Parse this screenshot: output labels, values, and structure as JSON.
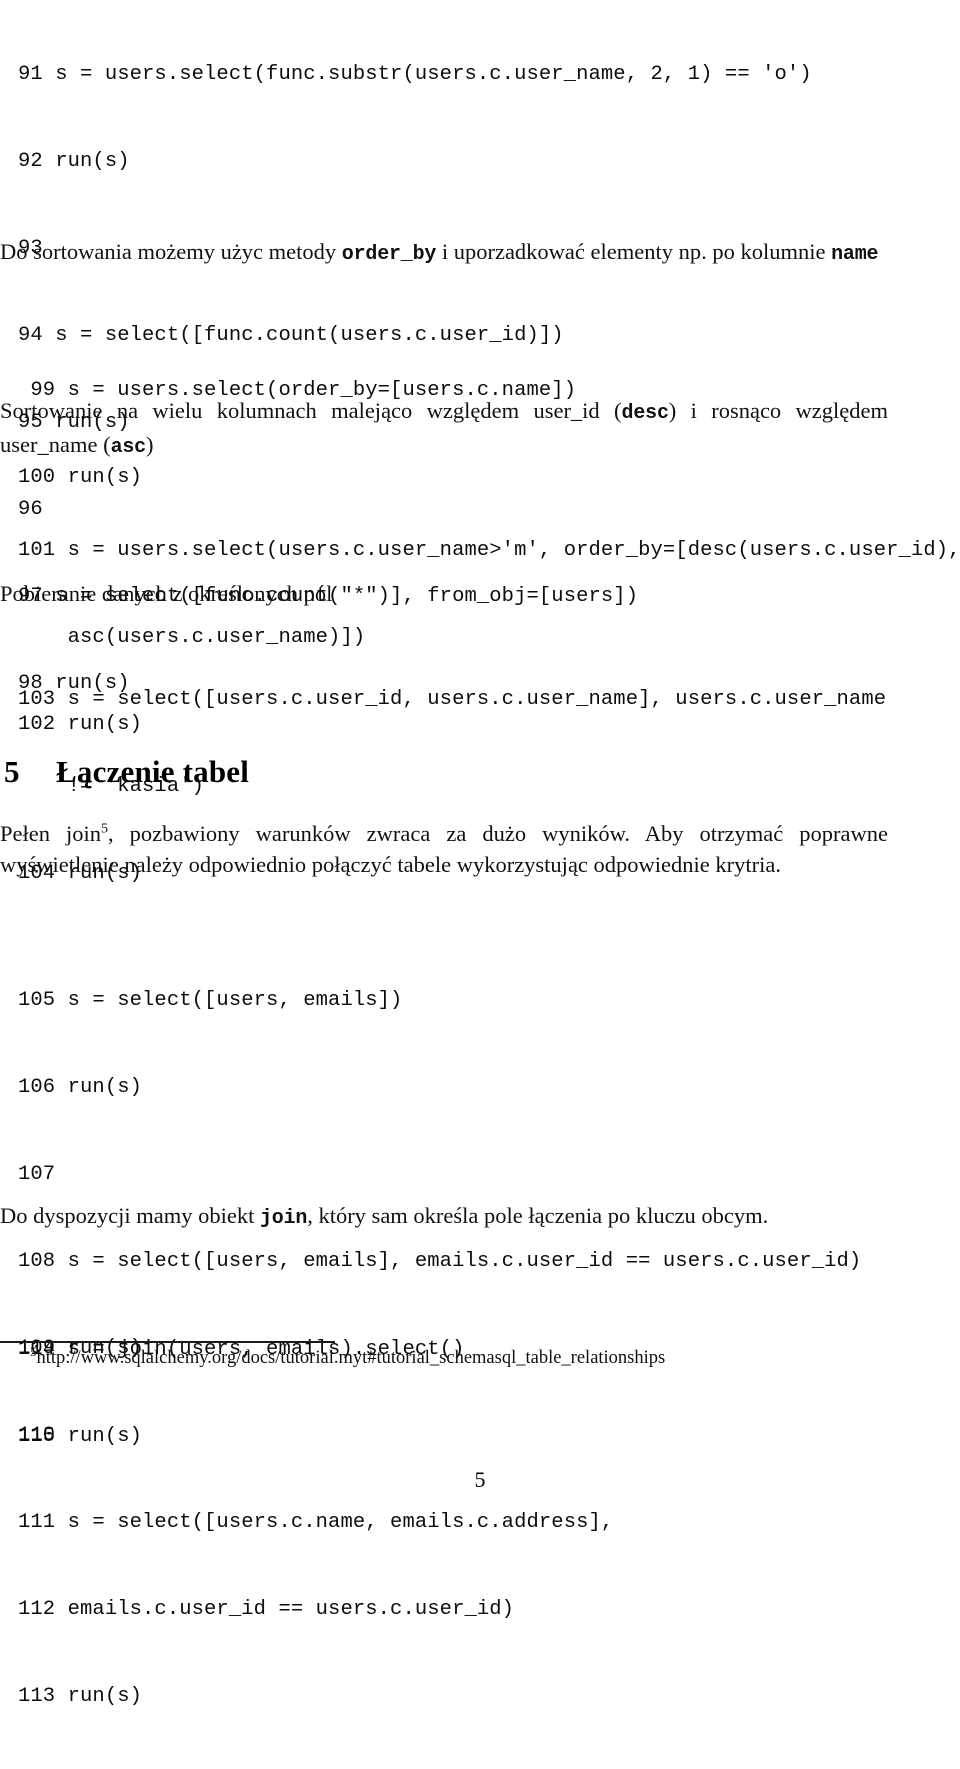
{
  "document": {
    "language": "pl",
    "page_number": "5"
  },
  "code_blocks": {
    "block_91": [
      "91 s = users.select(func.substr(users.c.user_name, 2, 1) == 'o')",
      "92 run(s)",
      "93",
      "94 s = select([func.count(users.c.user_id)])",
      "95 run(s)",
      "96",
      "97 s = select([func.count(\"*\")], from_obj=[users])",
      "98 run(s)"
    ],
    "block_99": [
      " 99 s = users.select(order_by=[users.c.name])",
      "100 run(s)"
    ],
    "block_101": [
      "101 s = users.select(users.c.user_name>'m', order_by=[desc(users.c.user_id),",
      "    asc(users.c.user_name)])",
      "102 run(s)"
    ],
    "block_103": [
      "103 s = select([users.c.user_id, users.c.user_name], users.c.user_name",
      "    != 'kasia')",
      "104 run(s)"
    ],
    "block_105": [
      "105 s = select([users, emails])",
      "106 run(s)",
      "107",
      "108 s = select([users, emails], emails.c.user_id == users.c.user_id)",
      "109 run(s)",
      "110",
      "111 s = select([users.c.name, emails.c.address],",
      "112 emails.c.user_id == users.c.user_id)",
      "113 run(s)"
    ],
    "block_114": [
      "114 s = join(users, emails).select()",
      "115 run(s)"
    ]
  },
  "paragraphs": {
    "sorting": {
      "part1": "Do sortowania możemy użyc metody ",
      "mono1": "order_by",
      "part2": " i uporzadkować elementy np. po kolumnie ",
      "mono2": "name"
    },
    "multi_column": {
      "part1": "Sortowanie na wielu kolumnach malejąco względem user_id (",
      "mono1": "desc",
      "part2": ") i rosnąco względem user_name (",
      "mono2": "asc",
      "part3": ")"
    },
    "fields": {
      "text": "Pobieranie danych z określonych pól"
    },
    "join_intro": {
      "part1": "Pełen join",
      "footnote_marker": "5",
      "part2": ", pozbawiony warunków zwraca za dużo wyników. Aby otrzymać poprawne wyświetlenie należy odpowiednio połączyć tabele wykorzystując odpowiednie krytria."
    },
    "join_object": {
      "part1": "Do dyspozycji mamy obiekt ",
      "mono1": "join",
      "part2": ", który sam określa pole łączenia po kluczu obcym."
    }
  },
  "heading": {
    "number": "5",
    "title": "Łączenie tabel"
  },
  "footnote": {
    "marker": "5",
    "url": "http://www.sqlalchemy.org/docs/tutorial.myt#tutorial_schemasql_table_relationships"
  }
}
